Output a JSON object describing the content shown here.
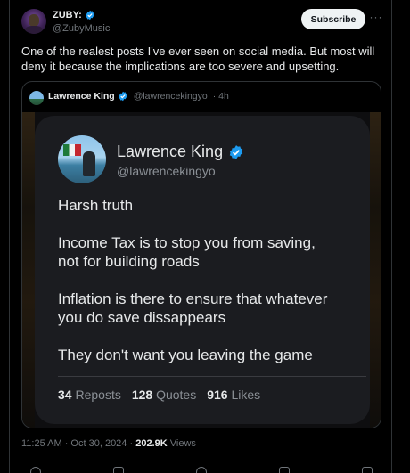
{
  "post": {
    "author_name": "ZUBY:",
    "author_handle": "@ZubyMusic",
    "subscribe_label": "Subscribe",
    "more_label": "···",
    "text": "One of the realest posts I've ever seen on social media. But  most will deny it because the implications are too severe and upsetting.",
    "timestamp": "11:25 AM · Oct 30, 2024 · ",
    "views_count": "202.9K",
    "views_label": " Views"
  },
  "quote": {
    "author_name": "Lawrence King",
    "author_handle": "@lawrencekingyo",
    "age": "· 4h"
  },
  "card": {
    "author_name": "Lawrence King",
    "author_handle": "@lawrencekingyo",
    "paragraphs": [
      "Harsh truth",
      "Income Tax is to stop you from saving,\nnot for building roads",
      "Inflation is there to ensure that whatever\nyou do save dissappears",
      "They don't want you leaving the game"
    ],
    "stats": [
      {
        "num": "34",
        "label": "Reposts"
      },
      {
        "num": "128",
        "label": "Quotes"
      },
      {
        "num": "916",
        "label": "Likes"
      }
    ]
  },
  "colors": {
    "background": "#000000",
    "verified_blue": "#1d9bf0",
    "muted_text": "#71767b",
    "card_bg": "#1b1c20"
  },
  "icons": [
    "verified-badge-icon",
    "more-options-icon",
    "reply-icon",
    "repost-icon",
    "like-icon",
    "bookmark-icon",
    "share-icon"
  ]
}
